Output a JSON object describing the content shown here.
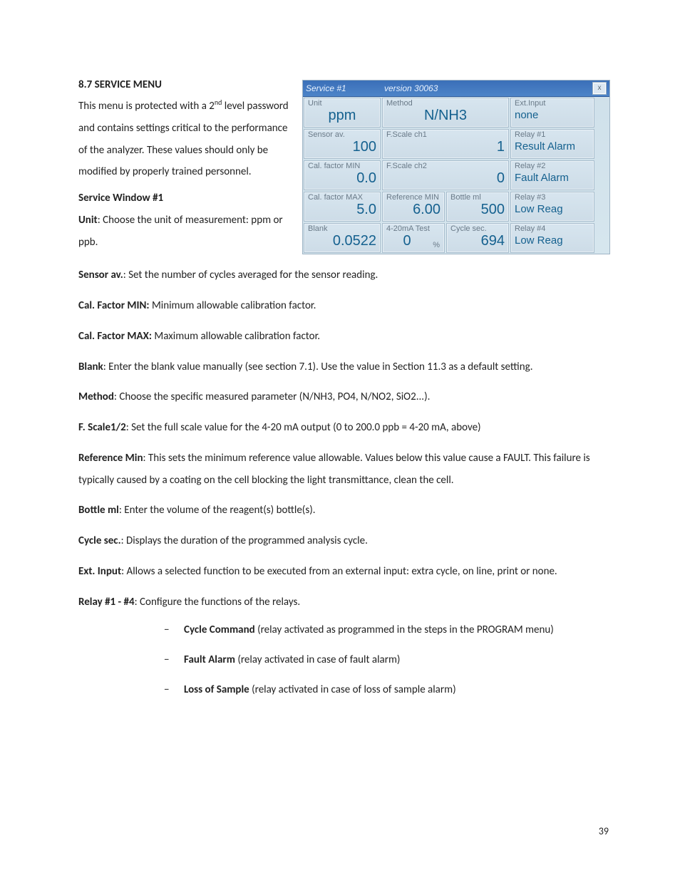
{
  "heading": "8.7 SERVICE MENU",
  "intro_lines": [
    "This menu is protected with a 2",
    " level password and contains settings critical to the performance of the analyzer. These values should only be modified by properly trained personnel."
  ],
  "sup": "nd",
  "subheading": "Service Window #1",
  "defs": {
    "unit": {
      "t": "Unit",
      "d": ": Choose the unit of measurement: ppm or ppb."
    },
    "sensor": {
      "t": "Sensor av.",
      "d": ": Set the number of cycles averaged for the sensor reading."
    },
    "cfmin": {
      "t": "Cal. Factor MIN:",
      "d": " Minimum allowable calibration factor."
    },
    "cfmax": {
      "t": "Cal. Factor MAX:",
      "d": " Maximum allowable calibration factor."
    },
    "blank": {
      "t": "Blank",
      "d": ": Enter the blank value manually (see section 7.1). Use the value in Section 11.3 as a default setting."
    },
    "method": {
      "t": "Method",
      "d": ": Choose the specific measured parameter (N/NH3, PO4, N/NO2, SiO2...)."
    },
    "fscale": {
      "t": "F. Scale1/2",
      "d": ": Set the full scale value for the 4-20 mA output (0 to 200.0 ppb = 4-20 mA, above)"
    },
    "refmin": {
      "t": "Reference Min",
      "d": ": This sets the minimum reference value allowable. Values below this value cause a FAULT. This failure is typically caused by a coating on the cell blocking the light transmittance, clean the cell."
    },
    "bottle": {
      "t": "Bottle ml",
      "d": ": Enter the volume of the reagent(s) bottle(s)."
    },
    "cycle": {
      "t": "Cycle sec.",
      "d": ": Displays the duration of the programmed analysis cycle."
    },
    "ext": {
      "t": "Ext. Input",
      "d": ": Allows a selected function to be executed from an external input: extra cycle, on line, print or none."
    },
    "relay": {
      "t": "Relay #1 - #4",
      "d": ": Configure the functions of the relays."
    }
  },
  "bullets": [
    {
      "t": "Cycle Command",
      "d": " (relay activated as programmed in the steps in the PROGRAM menu)"
    },
    {
      "t": "Fault Alarm",
      "d": " (relay activated in case of fault alarm)"
    },
    {
      "t": "Loss of Sample",
      "d": " (relay activated in case of loss of sample alarm)"
    }
  ],
  "shot": {
    "title_svc": "Service #1",
    "title_ver": "version  30063",
    "close": "x",
    "cells": {
      "unit": {
        "lbl": "Unit",
        "val": "ppm"
      },
      "method": {
        "lbl": "Method",
        "val": "N/NH3"
      },
      "ext": {
        "lbl": "Ext.Input",
        "val": "none"
      },
      "sensor": {
        "lbl": "Sensor av.",
        "val": "100"
      },
      "fs1": {
        "lbl": "F.Scale ch1",
        "val": "1"
      },
      "r1": {
        "lbl": "Relay #1",
        "val": "Result Alarm"
      },
      "cfmin": {
        "lbl": "Cal. factor MIN",
        "val": "0.0"
      },
      "fs2": {
        "lbl": "F.Scale ch2",
        "val": "0"
      },
      "r2": {
        "lbl": "Relay #2",
        "val": "Fault Alarm"
      },
      "cfmax": {
        "lbl": "Cal. factor MAX",
        "val": "5.0"
      },
      "refmin": {
        "lbl": "Reference MIN",
        "val": "6.00"
      },
      "bottle": {
        "lbl": "Bottle ml",
        "val": "500"
      },
      "r3": {
        "lbl": "Relay #3",
        "val": "Low Reag"
      },
      "blank": {
        "lbl": "Blank",
        "val": "0.0522"
      },
      "test": {
        "lbl": "4-20mA Test",
        "val": "0",
        "suffix": "%"
      },
      "cycle": {
        "lbl": "Cycle sec.",
        "val": "694"
      },
      "r4": {
        "lbl": "Relay #4",
        "val": "Low Reag"
      }
    }
  },
  "page_number": "39"
}
